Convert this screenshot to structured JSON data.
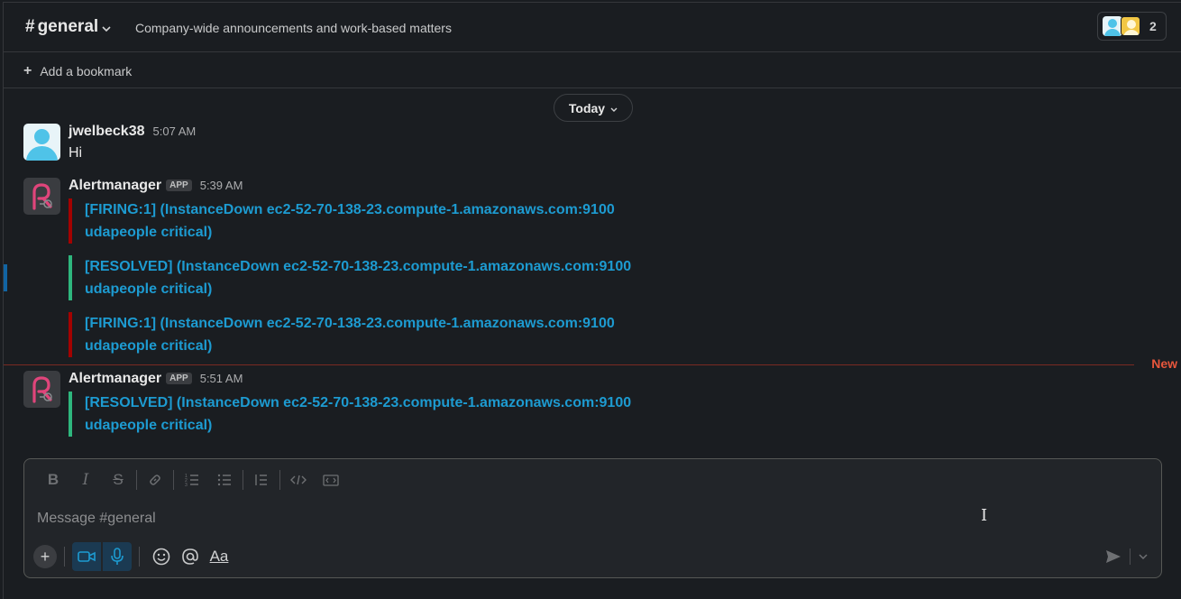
{
  "channel": {
    "hash": "#",
    "name": "general",
    "topic": "Company-wide announcements and work-based matters",
    "member_count": "2"
  },
  "bookmarks": {
    "add_label": "Add a bookmark"
  },
  "day_divider": {
    "label": "Today"
  },
  "messages": [
    {
      "sender": "jwelbeck38",
      "time": "5:07 AM",
      "text": "Hi"
    },
    {
      "sender": "Alertmanager",
      "badge": "APP",
      "time": "5:39 AM",
      "attachments": [
        {
          "status": "firing",
          "line1": "[FIRING:1]  (InstanceDown ec2-52-70-138-23.compute-1.amazonaws.com:9100",
          "line2": "udapeople critical)"
        },
        {
          "status": "resolved",
          "line1": "[RESOLVED]  (InstanceDown ec2-52-70-138-23.compute-1.amazonaws.com:9100",
          "line2": "udapeople critical)"
        },
        {
          "status": "firing",
          "line1": "[FIRING:1]  (InstanceDown ec2-52-70-138-23.compute-1.amazonaws.com:9100",
          "line2": "udapeople critical)"
        }
      ]
    },
    {
      "sender": "Alertmanager",
      "badge": "APP",
      "time": "5:51 AM",
      "attachments": [
        {
          "status": "resolved",
          "line1": "[RESOLVED]  (InstanceDown ec2-52-70-138-23.compute-1.amazonaws.com:9100",
          "line2": "udapeople critical)"
        }
      ]
    }
  ],
  "new_divider": {
    "label": "New"
  },
  "composer": {
    "placeholder": "Message #general",
    "format_aa": "Aa"
  },
  "colors": {
    "firing": "#a30200",
    "resolved": "#2eb67d",
    "link": "#1d9bd1",
    "new": "#e8563c"
  }
}
